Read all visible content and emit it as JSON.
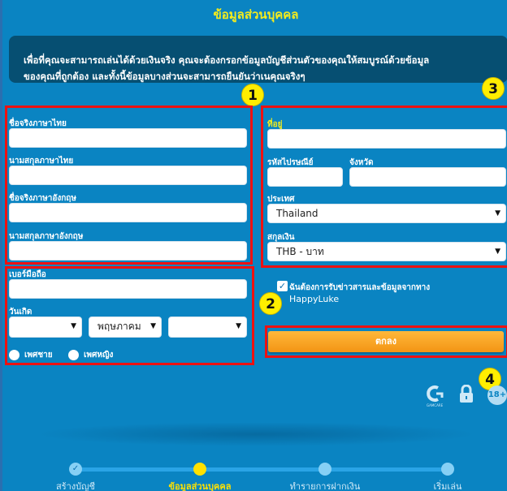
{
  "page": {
    "title": "ข้อมูลส่วนบุคคล",
    "info_line1": "เพื่อที่คุณจะสามารถเล่นได้ด้วยเงินจริง คุณจะต้องกรอกข้อมูลบัญชีส่วนตัวของคุณให้สมบูรณ์ด้วยข้อมูล",
    "info_line2": "ของคุณที่ถูกต้อง และทั้งนี้ข้อมูลบางส่วนจะสามารถยืนยันว่าเนคุณจริงๆ"
  },
  "badges": [
    "1",
    "2",
    "3",
    "4"
  ],
  "left_form": {
    "first_name_th_label": "ชื่อจริงภาษาไทย",
    "first_name_th_value": "",
    "last_name_th_label": "นามสกุลภาษาไทย",
    "last_name_th_value": "",
    "first_name_en_label": "ชื่อจริงภาษาอังกฤษ",
    "first_name_en_value": "",
    "last_name_en_label": "นามสกุลภาษาอังกฤษ",
    "last_name_en_value": "",
    "mobile_label": "เบอร์มือถือ",
    "mobile_value": "",
    "birthdate_label": "วันเกิด",
    "birth_day": "",
    "birth_month": "พฤษภาคม",
    "birth_year": "",
    "gender_male": "เพศชาย",
    "gender_female": "เพศหญิง"
  },
  "right_form": {
    "address_label": "ที่อยู่",
    "address_value": "",
    "postcode_label": "รหัสไปรษณีย์",
    "postcode_value": "",
    "province_label": "จังหวัด",
    "province_value": "",
    "country_label": "ประเทศ",
    "country_value": "Thailand",
    "currency_label": "สกุลเงิน",
    "currency_value": "THB - บาท"
  },
  "newsletter": {
    "checked": true,
    "label_line1": "ฉันต้องการรับข่าวสารและข้อมูลจากทาง",
    "label_line2": "HappyLuke"
  },
  "submit_label": "ตกลง",
  "trust_icons": {
    "gamcare_text": "GAMCARE",
    "age_text": "18+"
  },
  "steps": [
    {
      "label": "สร้างบัญชี",
      "state": "done"
    },
    {
      "label": "ข้อมูลส่วนบุคคล",
      "state": "active"
    },
    {
      "label": "ทำรายการฝากเงิน",
      "state": "pending"
    },
    {
      "label": "เริ่มเล่น",
      "state": "pending"
    }
  ],
  "dropdown_arrow": "▼",
  "check_mark": "✓"
}
